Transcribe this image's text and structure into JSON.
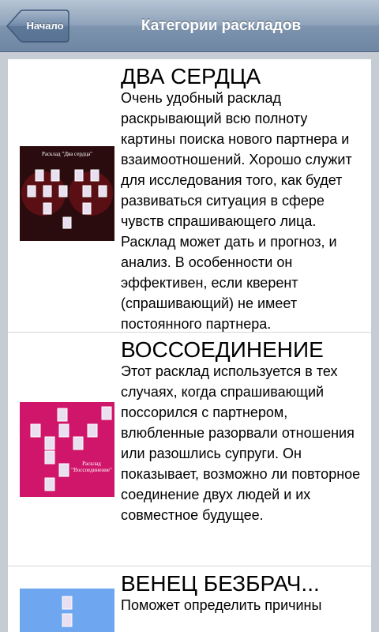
{
  "navbar": {
    "back_label": "Начало",
    "title": "Категории раскладов"
  },
  "items": [
    {
      "title": "ДВА СЕРДЦА",
      "description": "Очень удобный расклад раскрывающий всю полноту картины поиска нового партнера и взаимоотношений. Хорошо служит для исследования того, как будет развиваться ситуация в сфере чувств спрашивающего лица. Расклад может дать и прогноз, и анализ. В особенности он эффективен, если кверент (спрашивающий) не имеет постоянного партнера.",
      "thumb_caption": "Расклад \"Два сердца\"",
      "thumb_bg": "#2a0c0e"
    },
    {
      "title": "ВОССОЕДИНЕНИЕ",
      "description": "Этот расклад используется в тех случаях, когда спрашивающий поссорился с партнером, влюбленные разорвали отношения или разошлись супруги. Он показывает, возможно ли повторное соединение двух людей и их совместное будущее.",
      "thumb_caption": "Расклад \"Воссоединение\"",
      "thumb_bg": "#d0166a"
    },
    {
      "title": "ВЕНЕЦ БЕЗБРАЧ...",
      "description": "Поможет определить причины",
      "thumb_bg": "#6ea6ef"
    }
  ]
}
